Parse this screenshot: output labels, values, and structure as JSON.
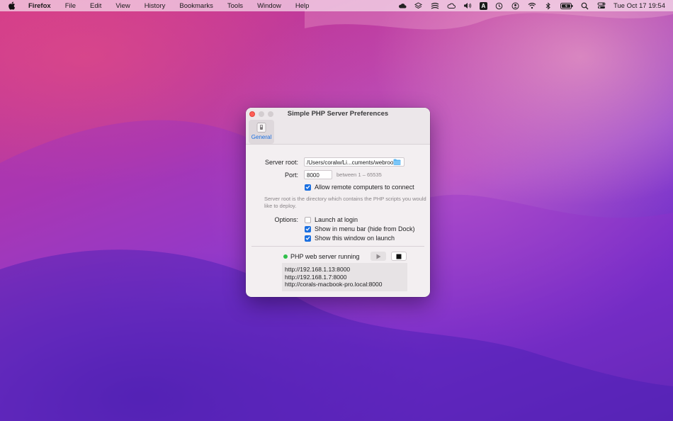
{
  "menubar": {
    "app_name": "Firefox",
    "items": [
      "File",
      "Edit",
      "View",
      "History",
      "Bookmarks",
      "Tools",
      "Window",
      "Help"
    ],
    "clock": "Tue Oct 17  19:54",
    "status_icons": [
      "cloud-icon",
      "layers-icon",
      "stripes-icon",
      "cloud-icon",
      "volume-icon",
      "text-input-icon",
      "time-machine-icon",
      "user-icon",
      "wifi-icon",
      "bluetooth-icon",
      "battery-icon",
      "search-icon",
      "control-center-icon"
    ],
    "input_badge": "A"
  },
  "window": {
    "title": "Simple PHP Server Preferences",
    "tab_general": "General",
    "server_root_label": "Server root:",
    "server_root_value": "/Users/coralw/Li...cuments/webroot",
    "port_label": "Port:",
    "port_value": "8000",
    "port_hint": "between 1 – 65535",
    "allow_remote_label": "Allow remote computers to connect",
    "allow_remote_checked": true,
    "description": "Server root is the directory which contains the PHP scripts you would like to deploy.",
    "options_label": "Options:",
    "options": [
      {
        "label": "Launch at login",
        "checked": false
      },
      {
        "label": "Show in menu bar (hide from Dock)",
        "checked": true
      },
      {
        "label": "Show this window on launch",
        "checked": true
      }
    ],
    "status_text": "PHP web server running",
    "status_color": "#2fbf4a",
    "urls": [
      "http://192.168.1.13:8000",
      "http://192.168.1.7:8000",
      "http://corals-macbook-pro.local:8000"
    ]
  },
  "colors": {
    "accent": "#1a6fe0",
    "close": "#ff5f57"
  }
}
